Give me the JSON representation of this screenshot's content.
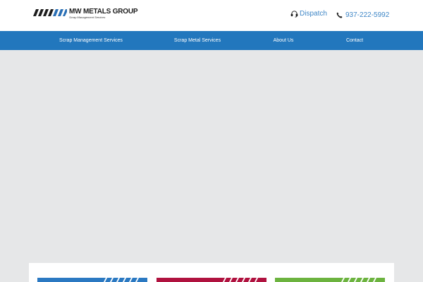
{
  "header": {
    "logo": {
      "name": "MW METALS GROUP",
      "tagline": "Scrap Management Services"
    },
    "dispatch": {
      "label": "Dispatch",
      "icon": "headset-icon"
    },
    "phone": {
      "number": "937-222-5992",
      "icon": "phone-icon"
    }
  },
  "nav": {
    "items": [
      {
        "label": "Scrap Management Services"
      },
      {
        "label": "Scrap Metal Services"
      },
      {
        "label": "About Us"
      },
      {
        "label": "Contact"
      }
    ]
  },
  "cards": [
    {
      "color": "#2b79c2"
    },
    {
      "color": "#b0123f"
    },
    {
      "color": "#6cb33f"
    }
  ],
  "colors": {
    "accent": "#2277bd",
    "link": "#3e86c6",
    "hero_bg": "#e6e7e8"
  }
}
